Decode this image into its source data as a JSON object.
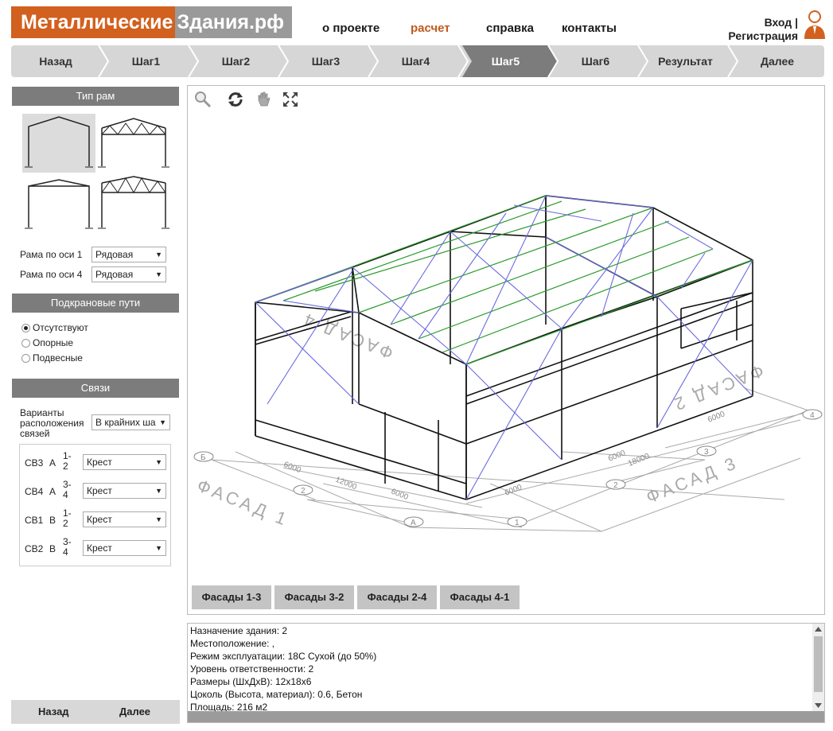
{
  "header": {
    "logo_part1": "Металлические",
    "logo_part2": "Здания.рф",
    "nav": [
      {
        "label": "о проекте"
      },
      {
        "label": "расчет"
      },
      {
        "label": "справка"
      },
      {
        "label": "контакты"
      }
    ],
    "login_label": "Вход |",
    "register_label": "Регистрация",
    "accent_color": "#d2601e"
  },
  "steps": {
    "items": [
      "Назад",
      "Шаг1",
      "Шаг2",
      "Шаг3",
      "Шаг4",
      "Шаг5",
      "Шаг6",
      "Результат",
      "Далее"
    ],
    "active": "Шаг5"
  },
  "frame_types": {
    "title": "Тип рам",
    "axis1_label": "Рама по оси 1",
    "axis1_value": "Рядовая",
    "axis4_label": "Рама по оси 4",
    "axis4_value": "Рядовая"
  },
  "crane": {
    "title": "Подкрановые пути",
    "options": [
      "Отсутствуют",
      "Опорные",
      "Подвесные"
    ],
    "selected": "Отсутствуют"
  },
  "ties": {
    "title": "Связи",
    "variants_label": "Варианты расположения связей",
    "variants_value": "В крайних ша",
    "rows": [
      {
        "code": "СВ3",
        "axis": "А",
        "span": "1-2",
        "value": "Крест"
      },
      {
        "code": "СВ4",
        "axis": "А",
        "span": "3-4",
        "value": "Крест"
      },
      {
        "code": "СВ1",
        "axis": "В",
        "span": "1-2",
        "value": "Крест"
      },
      {
        "code": "СВ2",
        "axis": "В",
        "span": "3-4",
        "value": "Крест"
      }
    ]
  },
  "left_bottom": {
    "back": "Назад",
    "next": "Далее"
  },
  "viewer": {
    "tools": [
      "search-icon",
      "rotate-icon",
      "pan-hand-icon",
      "fullscreen-icon"
    ],
    "labels": {
      "dim1": "6000",
      "dim2": "12000",
      "dim3": "6000",
      "dim4": "6000",
      "dim5": "18000",
      "dim6": "6000",
      "dim7": "6000",
      "facade1": "ФАСАД 1",
      "facade3": "ФАСАД 3",
      "facade2": "ФАСАД 2",
      "facade4": "ФАСАД 4",
      "axisA": "А",
      "axisB": "Б",
      "axisV": "В",
      "ax1": "1",
      "ax2": "2",
      "ax3": "3",
      "ax4": "4"
    },
    "facade_buttons": [
      "Фасады 1-3",
      "Фасады 3-2",
      "Фасады 2-4",
      "Фасады 4-1"
    ]
  },
  "info": {
    "lines": [
      "Назначение здания: 2",
      "Местоположение: ,",
      "Режим эксплуатации: 18С Сухой (до 50%)",
      "Уровень ответственности: 2",
      "Размеры (ШхДхВ): 12х18х6",
      "Цоколь (Высота, материал): 0.6, Бетон",
      "Площадь: 216 м2"
    ]
  }
}
